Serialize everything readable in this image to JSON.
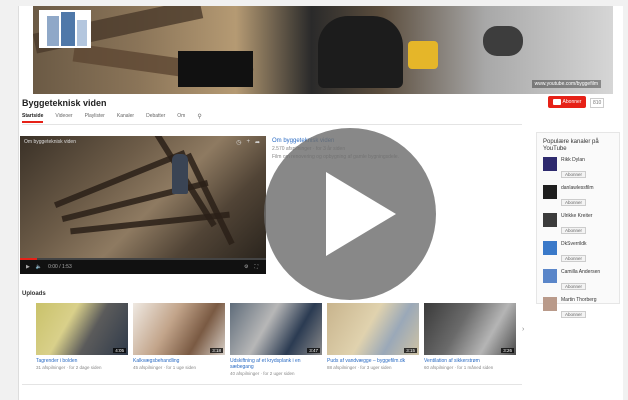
{
  "channel": {
    "title": "Byggeteknisk viden",
    "subscribe_label": "Abonner",
    "subscriber_count": "810",
    "banner_link": "www.youtube.com/byggefilm"
  },
  "tabs": [
    {
      "label": "Startside"
    },
    {
      "label": "Videoer"
    },
    {
      "label": "Playlister"
    },
    {
      "label": "Kanaler"
    },
    {
      "label": "Debatter"
    },
    {
      "label": "Om"
    }
  ],
  "featured": {
    "player_title": "Om byggeteknisk viden",
    "title": "Om byggeteknisk viden",
    "meta": "2.570 afspilninger · for 3 år siden",
    "description": "Film om renovering og opbygning af gamle bygningsdele.",
    "time": "0:00 / 1:53",
    "progress": 0.07
  },
  "uploads": {
    "heading": "Uploads",
    "items": [
      {
        "title": "Tagrender i bolden",
        "meta": "31 afspilninger · for 2 dage siden",
        "duration": "4:05"
      },
      {
        "title": "Kalkvægsbehandling",
        "meta": "45 afspilninger · for 1 uge siden",
        "duration": "3:18"
      },
      {
        "title": "Udskiftning af et krydsplank i en sæbegang",
        "meta": "40 afspilninger · for 2 uger siden",
        "duration": "3:47"
      },
      {
        "title": "Puds af vandvægge – byggefilm.dk",
        "meta": "88 afspilninger · for 3 uger siden",
        "duration": "3:15"
      },
      {
        "title": "Ventilation af sikkerstrøm",
        "meta": "60 afspilninger · for 1 måned siden",
        "duration": "3:26"
      }
    ]
  },
  "sidebar": {
    "heading": "Populære kanaler på YouTube",
    "channels": [
      {
        "name": "Rikk Dylan",
        "button": "Abonner",
        "color": "#2e2a6e"
      },
      {
        "name": "danlawlessfilm",
        "button": "Abonner",
        "color": "#1f1f1f"
      },
      {
        "name": "Ulrikke Kreiter",
        "button": "Abonner",
        "color": "#3b3b3b"
      },
      {
        "name": "DkSverrildk",
        "button": "Abonner",
        "color": "#3a79c9"
      },
      {
        "name": "Camilla Andersen",
        "button": "Abonner",
        "color": "#5a86c9"
      },
      {
        "name": "Martin Thorberg",
        "button": "Abonner",
        "color": "#b99a8a"
      }
    ]
  },
  "colors": {
    "accent": "#e62117",
    "link": "#2a6bc4"
  }
}
